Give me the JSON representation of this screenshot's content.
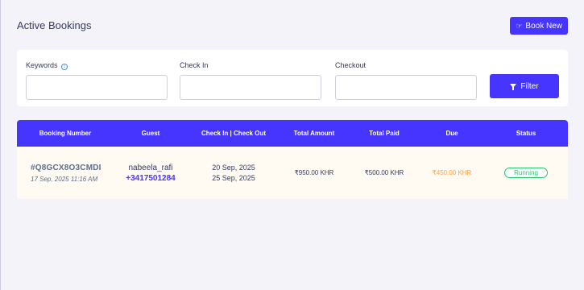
{
  "header": {
    "title": "Active Bookings",
    "book_new_label": "Book New",
    "book_new_icon": "hand-pointing-icon"
  },
  "filters": {
    "keywords_label": "Keywords",
    "keywords_value": "",
    "checkin_label": "Check In",
    "checkin_value": "",
    "checkout_label": "Checkout",
    "checkout_value": "",
    "filter_button_label": "Filter"
  },
  "table": {
    "columns": [
      "Booking Number",
      "Guest",
      "Check In | Check Out",
      "Total Amount",
      "Total Paid",
      "Due",
      "Status"
    ],
    "rows": [
      {
        "booking_number": "#Q8GCX8O3CMDI",
        "booking_date": "17 Sep, 2025 11:16 AM",
        "guest_name": "nabeela_rafi",
        "guest_phone": "+3417501284",
        "check_in": "20 Sep, 2025",
        "check_out": "25 Sep, 2025",
        "total_amount": "₹950.00 KHR",
        "total_paid": "₹500.00 KHR",
        "due": "₹450.00 KHR",
        "status": "Running"
      }
    ]
  },
  "colors": {
    "primary": "#4634ff",
    "due": "#ff9f43",
    "status_running": "#28c76f"
  }
}
